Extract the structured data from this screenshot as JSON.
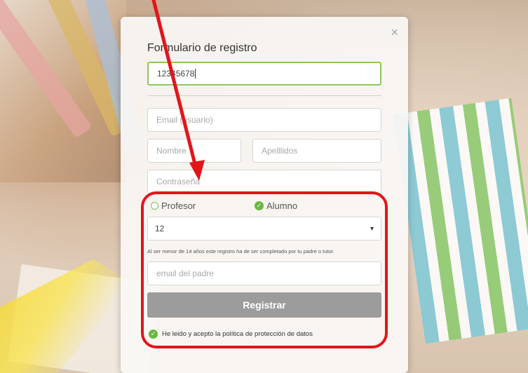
{
  "modal": {
    "title": "Formulario de registro",
    "close_icon": "×",
    "code_value": "12345678",
    "email_placeholder": "Email (usuario)",
    "name_placeholder": "Nombre",
    "surname_placeholder": "Apelllidos",
    "password_placeholder": "Contraseña",
    "role_options": [
      {
        "label": "Profesor",
        "selected": false
      },
      {
        "label": "Alumno",
        "selected": true
      }
    ],
    "age_value": "12",
    "age_dropdown_icon": "▾",
    "minor_notice": "Al ser menor de 14 años este registro ha de ser completado por tu padre o tutor.",
    "parent_email_placeholder": "email del padre",
    "submit_label": "Registrar",
    "consent_text": "He leido y acepto la política de protección de datos",
    "consent_checked": true
  },
  "colors": {
    "focus_border": "#8cc85a",
    "check_green": "#69b941",
    "button_gray": "#9c9c9c",
    "annotation_red": "#e2151b"
  },
  "annotations": {
    "arrow_icon": "red-arrow",
    "highlight_box": "red-rounded-rectangle"
  }
}
